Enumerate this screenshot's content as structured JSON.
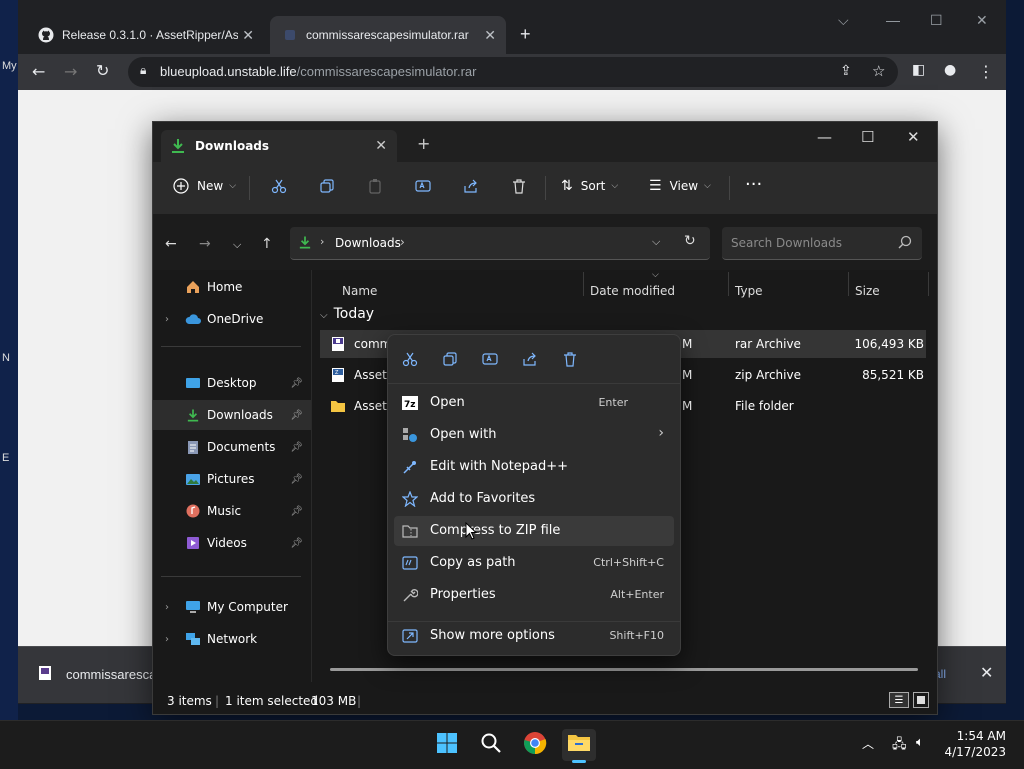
{
  "desktop": {
    "glyphs": [
      "My",
      "N",
      "E"
    ]
  },
  "chrome": {
    "tabs": [
      {
        "title": "Release 0.3.1.0 · AssetRipper/Asse",
        "icon": "github-icon"
      },
      {
        "title": "commissarescapesimulator.rar",
        "icon": "page-icon"
      }
    ],
    "url_host": "blueupload.unstable.life",
    "url_path": "/commissarescapesimulator.rar",
    "download_bar": {
      "file_name": "commissaresca",
      "show_all": "all"
    }
  },
  "explorer": {
    "tab_title": "Downloads",
    "commands": {
      "new": "New",
      "sort": "Sort",
      "view": "View"
    },
    "address": "Downloads",
    "search_placeholder": "Search Downloads",
    "nav": [
      {
        "label": "Home",
        "icon": "home-icon",
        "pinned": false
      },
      {
        "label": "OneDrive",
        "icon": "cloud-icon",
        "pinned": false
      },
      {
        "label": "Desktop",
        "icon": "desktop-icon",
        "pinned": true
      },
      {
        "label": "Downloads",
        "icon": "download-icon",
        "pinned": true
      },
      {
        "label": "Documents",
        "icon": "documents-icon",
        "pinned": true
      },
      {
        "label": "Pictures",
        "icon": "pictures-icon",
        "pinned": true
      },
      {
        "label": "Music",
        "icon": "music-icon",
        "pinned": true
      },
      {
        "label": "Videos",
        "icon": "videos-icon",
        "pinned": true
      },
      {
        "label": "My Computer",
        "icon": "computer-icon",
        "pinned": false
      },
      {
        "label": "Network",
        "icon": "network-icon",
        "pinned": false
      }
    ],
    "columns": {
      "name": "Name",
      "date": "Date modified",
      "type": "Type",
      "size": "Size"
    },
    "group": "Today",
    "files": [
      {
        "name": "commi",
        "date_tail": "M",
        "type": "rar Archive",
        "size": "106,493 KB",
        "icon": "rar-file-icon",
        "selected": true
      },
      {
        "name": "AssetR",
        "date_tail": "M",
        "type": "zip Archive",
        "size": "85,521 KB",
        "icon": "zip-file-icon",
        "selected": false
      },
      {
        "name": "AssetR",
        "date_tail": "M",
        "type": "File folder",
        "size": "",
        "icon": "folder-icon",
        "selected": false
      }
    ],
    "status": {
      "items": "3 items",
      "selected": "1 item selected",
      "size": "103 MB"
    }
  },
  "context_menu": {
    "items": [
      {
        "label": "Open",
        "shortcut": "Enter",
        "icon": "7zip-icon"
      },
      {
        "label": "Open with",
        "shortcut": "",
        "icon": "open-with-icon",
        "submenu": true
      },
      {
        "label": "Edit with Notepad++",
        "shortcut": "",
        "icon": "notepadpp-icon"
      },
      {
        "label": "Add to Favorites",
        "shortcut": "",
        "icon": "star-icon"
      },
      {
        "label": "Compress to ZIP file",
        "shortcut": "",
        "icon": "zip-compress-icon",
        "hover": true
      },
      {
        "label": "Copy as path",
        "shortcut": "Ctrl+Shift+C",
        "icon": "copy-path-icon"
      },
      {
        "label": "Properties",
        "shortcut": "Alt+Enter",
        "icon": "wrench-icon"
      },
      {
        "label": "Show more options",
        "shortcut": "Shift+F10",
        "icon": "more-options-icon"
      }
    ]
  },
  "taskbar": {
    "time": "1:54 AM",
    "date": "4/17/2023"
  },
  "colors": {
    "accent": "#4cc2ff",
    "download_green": "#3fb950",
    "folder": "#f4c542"
  }
}
